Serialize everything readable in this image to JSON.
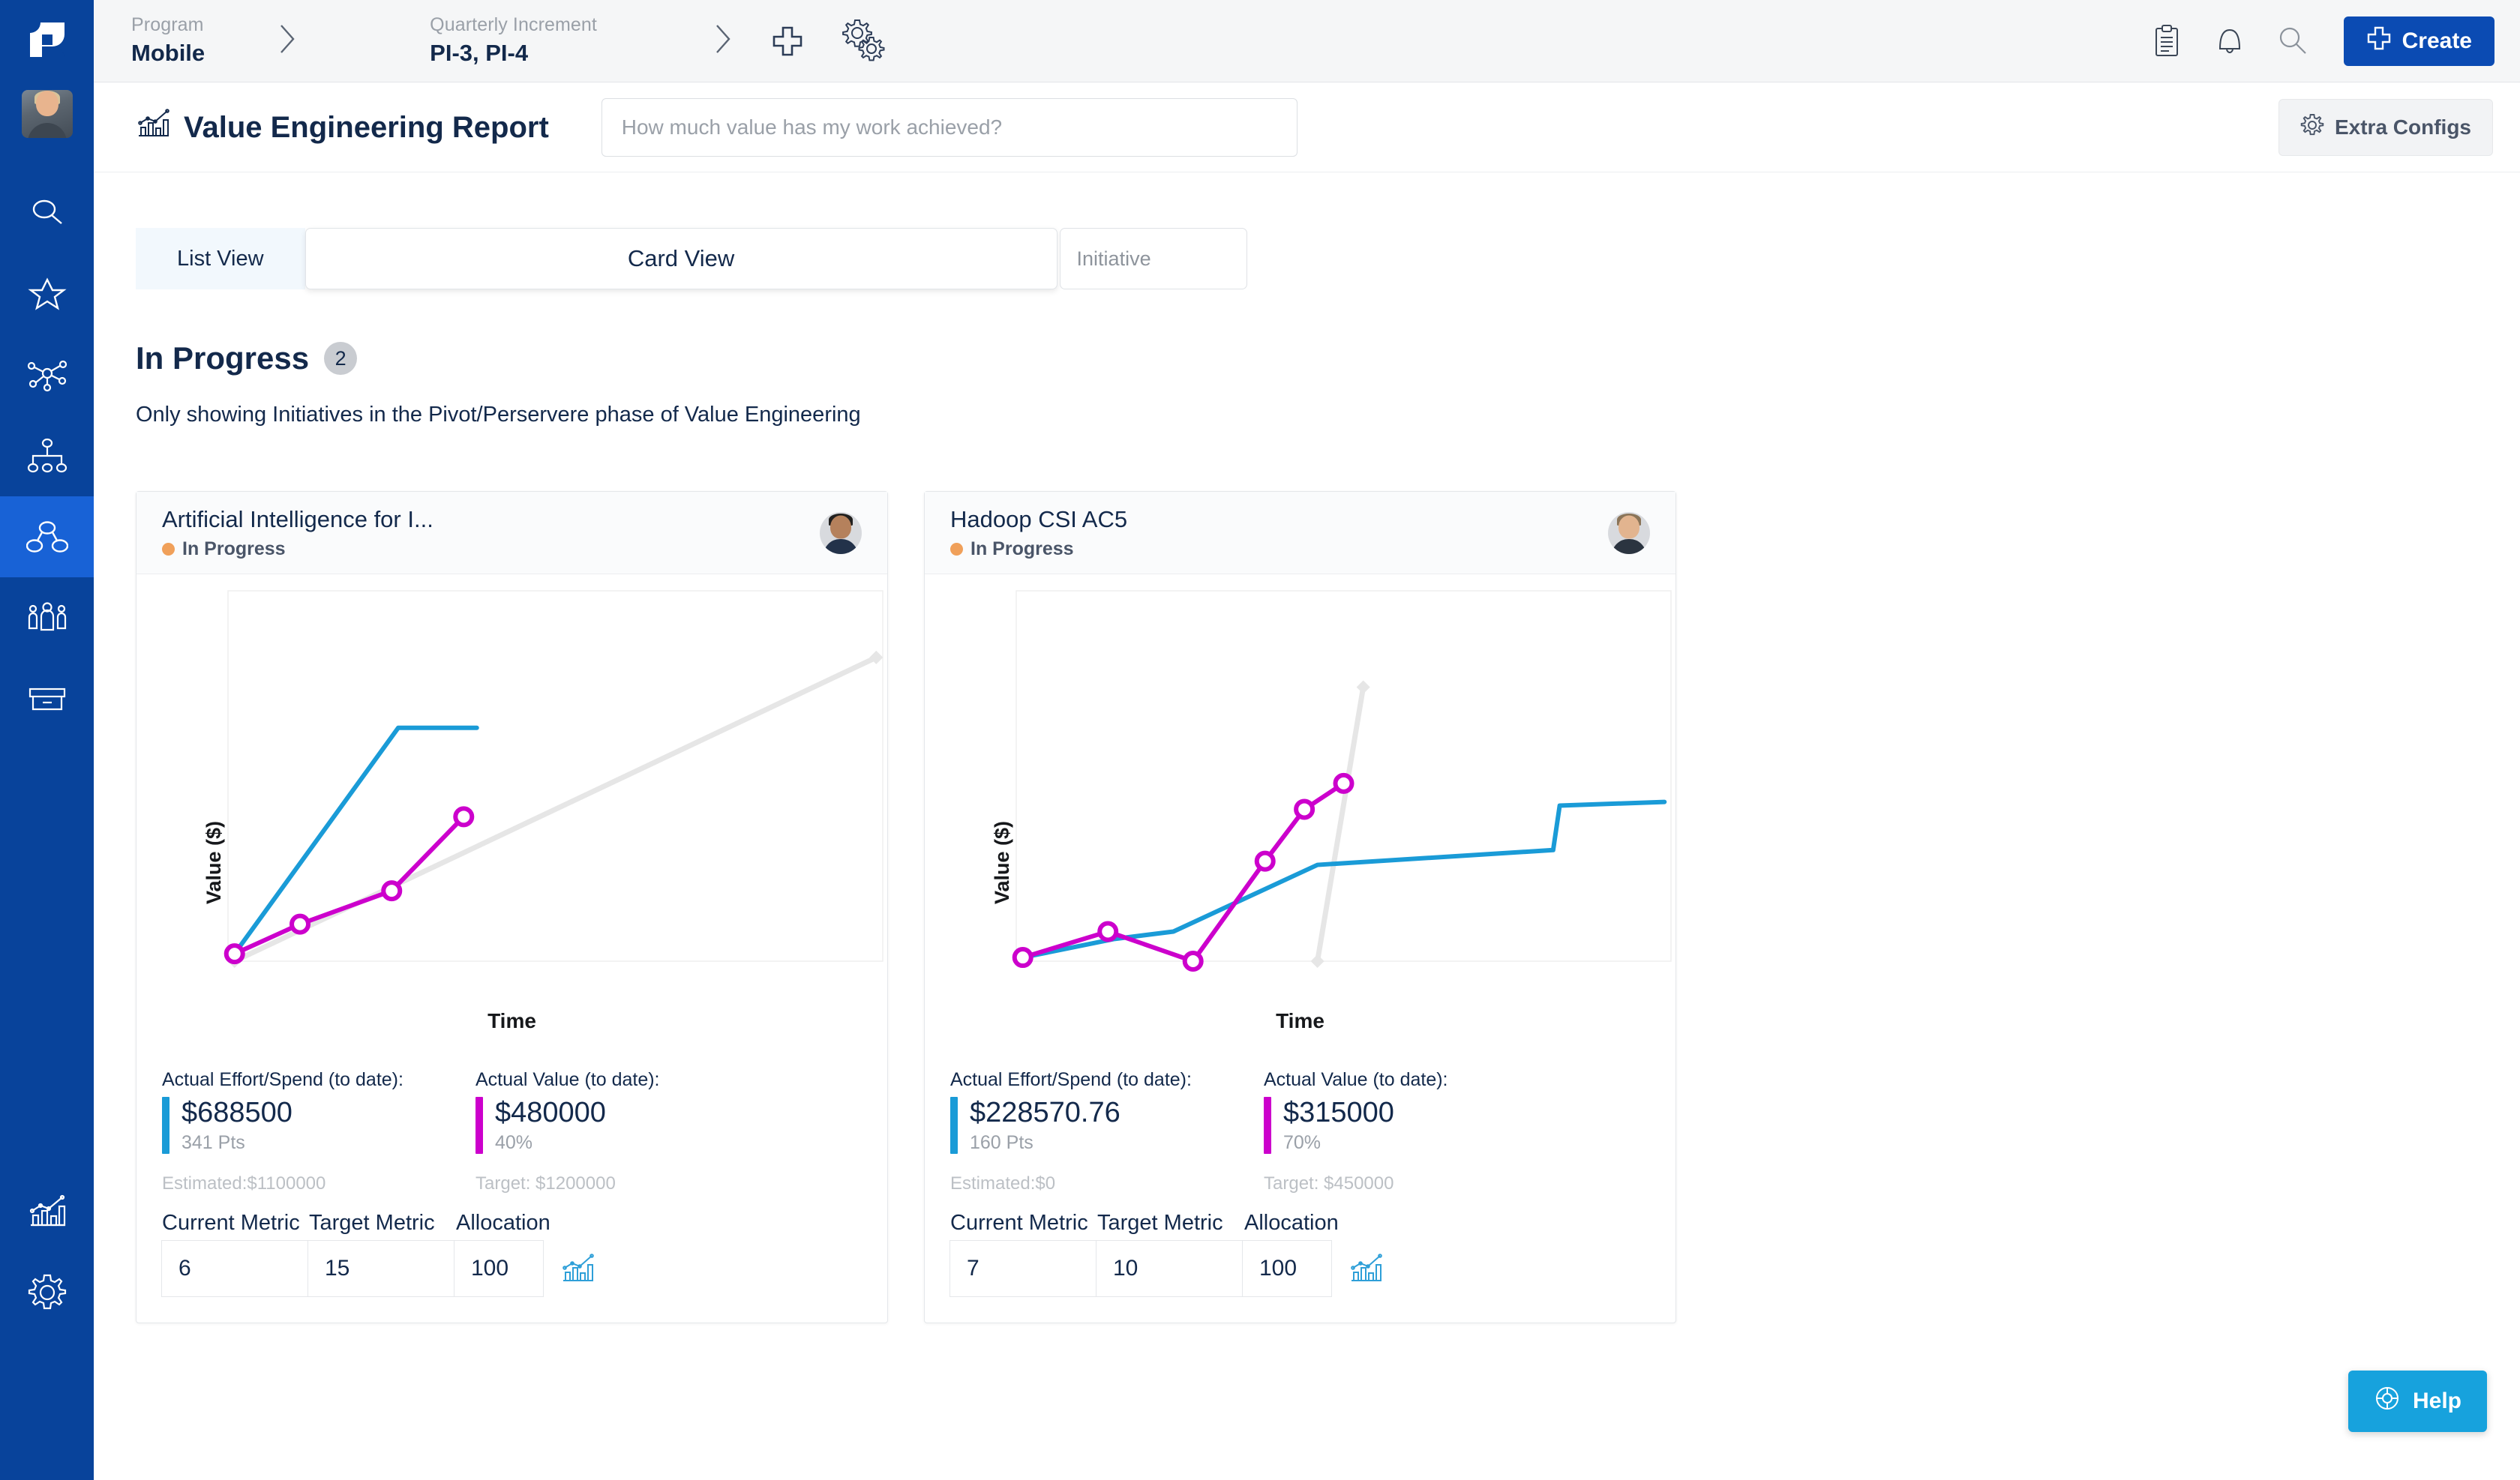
{
  "brand": {
    "logo_name": "logo-icon",
    "accent_blue": "#08439b",
    "active_blue": "#1862d6"
  },
  "sidebar": {
    "items": [
      {
        "name": "search-icon",
        "label": "Search"
      },
      {
        "name": "star-icon",
        "label": "Favorites"
      },
      {
        "name": "network-icon",
        "label": "Network"
      },
      {
        "name": "hierarchy-icon",
        "label": "Hierarchy"
      },
      {
        "name": "teams-icon",
        "label": "Teams",
        "active": true
      },
      {
        "name": "people-icon",
        "label": "People"
      },
      {
        "name": "box-icon",
        "label": "Backlog"
      }
    ],
    "bottom_items": [
      {
        "name": "analytics-icon",
        "label": "Analytics"
      },
      {
        "name": "gear-icon",
        "label": "Settings"
      }
    ]
  },
  "topbar": {
    "breadcrumbs": [
      {
        "label": "Program",
        "value": "Mobile"
      },
      {
        "label": "Quarterly Increment",
        "value": "PI-3, PI-4"
      }
    ],
    "add_icon": "plus-icon",
    "settings_icon": "gears-icon",
    "right_icons": [
      "clipboard-icon",
      "bell-icon",
      "search-icon"
    ],
    "create_label": "Create"
  },
  "page": {
    "title": "Value Engineering Report",
    "title_icon": "chart-report-icon",
    "ask_placeholder": "How much value has my work achieved?",
    "ask_value": "",
    "extra_configs_label": "Extra Configs",
    "extra_configs_icon": "gear-icon"
  },
  "tabs": [
    {
      "label": "List View",
      "active": false
    },
    {
      "label": "Card View",
      "active": true
    }
  ],
  "initiative_filter": {
    "placeholder": "Initiative",
    "value": ""
  },
  "section": {
    "title": "In Progress",
    "count": "2",
    "subtitle": "Only showing Initiatives in the Pivot/Perservere phase of Value Engineering"
  },
  "colors": {
    "effort_blue": "#1a9bd7",
    "value_magenta": "#cc00cc",
    "target_gray": "#e6e6e6",
    "status_orange": "#f0a05a"
  },
  "cards": [
    {
      "title": "Artificial Intelligence for I...",
      "status": "In Progress",
      "avatar": "avatar",
      "effort": {
        "label": "Actual Effort/Spend (to date):",
        "value": "$688500",
        "sub": "341 Pts",
        "footer": "Estimated:$1100000"
      },
      "value": {
        "label": "Actual Value (to date):",
        "value": "$480000",
        "sub": "40%",
        "footer": "Target: $1200000"
      },
      "metrics": {
        "headers": [
          "Current Metric",
          "Target Metric",
          "Allocation"
        ],
        "values": [
          "6",
          "15",
          "100"
        ],
        "chart_icon": "mini-chart-icon"
      },
      "chart_data": {
        "type": "line",
        "title": "",
        "xlabel": "Time",
        "ylabel": "Value ($)",
        "xlim": [
          0,
          100
        ],
        "ylim": [
          0,
          100
        ],
        "grid": false,
        "legend": "none",
        "series": [
          {
            "name": "Actual Effort/Spend",
            "color": "#1a9bd7",
            "markers": false,
            "points": [
              [
                1,
                2
              ],
              [
                26,
                63
              ],
              [
                38,
                63
              ]
            ]
          },
          {
            "name": "Actual Value",
            "color": "#cc00cc",
            "markers": true,
            "points": [
              [
                1,
                2
              ],
              [
                11,
                10
              ],
              [
                25,
                19
              ],
              [
                36,
                39
              ]
            ]
          },
          {
            "name": "Target",
            "color": "#e6e6e6",
            "markers": false,
            "end_marker": "diamond",
            "points": [
              [
                1,
                0
              ],
              [
                99,
                82
              ]
            ]
          }
        ]
      }
    },
    {
      "title": "Hadoop CSI AC5",
      "status": "In Progress",
      "avatar": "avatar",
      "effort": {
        "label": "Actual Effort/Spend (to date):",
        "value": "$228570.76",
        "sub": "160 Pts",
        "footer": "Estimated:$0"
      },
      "value": {
        "label": "Actual Value (to date):",
        "value": "$315000",
        "sub": "70%",
        "footer": "Target: $450000"
      },
      "metrics": {
        "headers": [
          "Current Metric",
          "Target Metric",
          "Allocation"
        ],
        "values": [
          "7",
          "10",
          "100"
        ],
        "chart_icon": "mini-chart-icon"
      },
      "chart_data": {
        "type": "line",
        "title": "",
        "xlabel": "Time",
        "ylabel": "Value ($)",
        "xlim": [
          0,
          100
        ],
        "ylim": [
          0,
          100
        ],
        "grid": false,
        "legend": "none",
        "series": [
          {
            "name": "Actual Effort/Spend",
            "color": "#1a9bd7",
            "markers": false,
            "points": [
              [
                1,
                1
              ],
              [
                15,
                6
              ],
              [
                24,
                8
              ],
              [
                46,
                26
              ],
              [
                82,
                30
              ],
              [
                83,
                42
              ],
              [
                99,
                43
              ]
            ]
          },
          {
            "name": "Actual Value",
            "color": "#cc00cc",
            "markers": true,
            "points": [
              [
                1,
                1
              ],
              [
                14,
                8
              ],
              [
                27,
                0
              ],
              [
                38,
                27
              ],
              [
                44,
                41
              ],
              [
                50,
                48
              ]
            ]
          },
          {
            "name": "Target",
            "color": "#e6e6e6",
            "markers": false,
            "end_marker": "diamond",
            "points": [
              [
                46,
                0
              ],
              [
                53,
                74
              ]
            ]
          }
        ]
      }
    }
  ],
  "help": {
    "label": "Help",
    "icon": "lifebuoy-icon"
  }
}
